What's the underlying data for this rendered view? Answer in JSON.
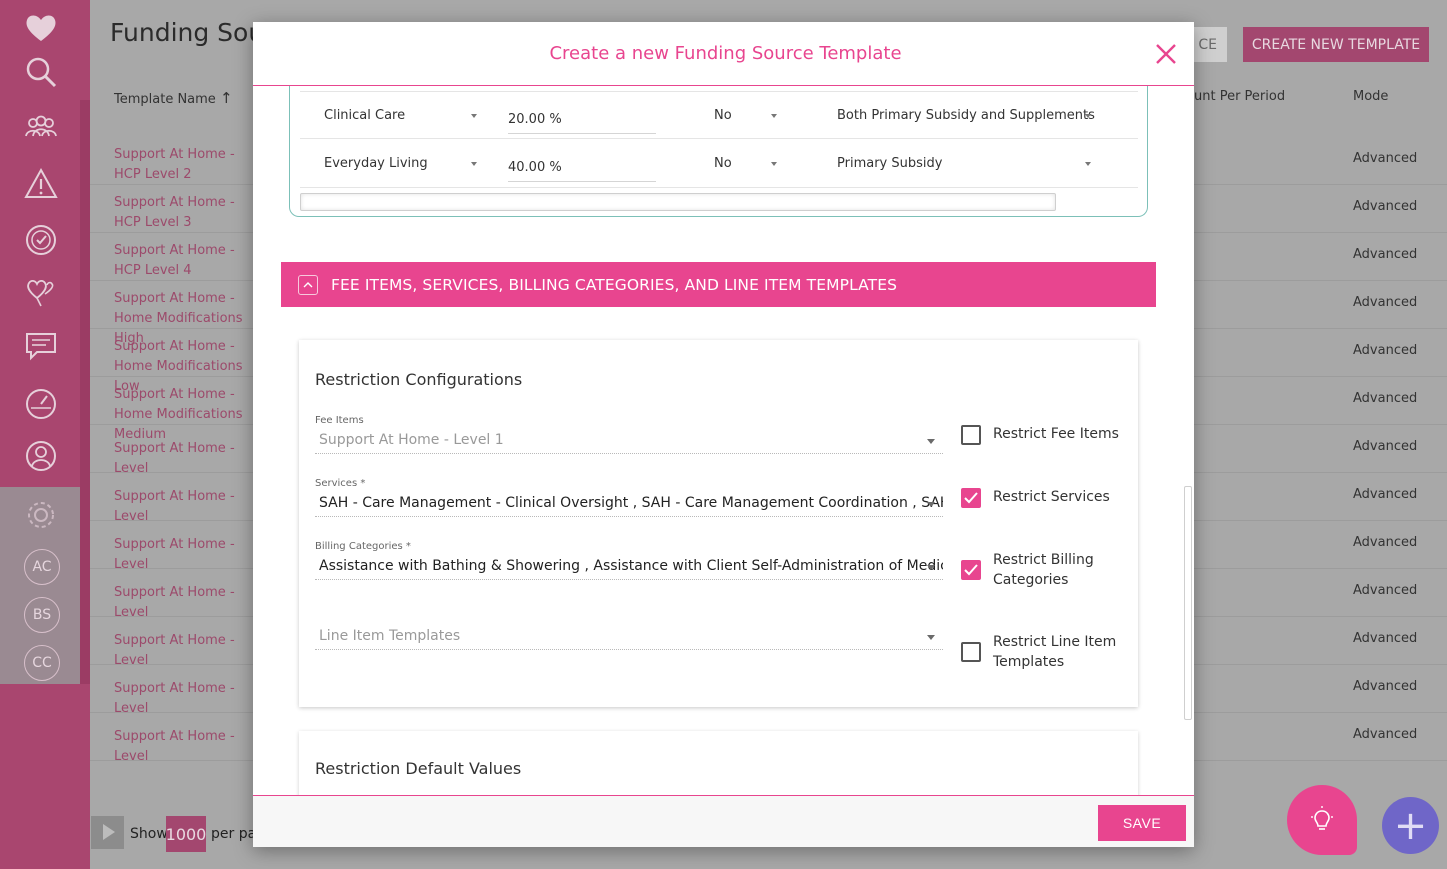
{
  "background": {
    "title": "Funding Sour",
    "buttons": {
      "partial_label": "CE",
      "create_label": "CREATE NEW TEMPLATE"
    },
    "columns": {
      "template_name": "Template Name",
      "amount": "unt Per Period",
      "mode": "Mode"
    },
    "rows": [
      {
        "name": "Support At Home - HCP Level 2",
        "mode": "Advanced"
      },
      {
        "name": "Support At Home - HCP Level 3",
        "mode": "Advanced"
      },
      {
        "name": "Support At Home - HCP Level 4",
        "mode": "Advanced"
      },
      {
        "name": "Support At Home - Home Modifications High",
        "mode": "Advanced"
      },
      {
        "name": "Support At Home - Home Modifications Low",
        "mode": "Advanced"
      },
      {
        "name": "Support At Home - Home Modifications Medium",
        "mode": "Advanced"
      },
      {
        "name": "Support At Home - Level",
        "mode": "Advanced"
      },
      {
        "name": "Support At Home - Level",
        "mode": "Advanced"
      },
      {
        "name": "Support At Home - Level",
        "mode": "Advanced"
      },
      {
        "name": "Support At Home - Level",
        "mode": "Advanced"
      },
      {
        "name": "Support At Home - Level",
        "mode": "Advanced"
      },
      {
        "name": "Support At Home - Level",
        "mode": "Advanced"
      },
      {
        "name": "Support At Home - Level",
        "mode": "Advanced"
      }
    ],
    "footer": {
      "show": "Show",
      "count": "1000",
      "per_page": "per pa"
    }
  },
  "sidebar": {
    "circles": [
      "AC",
      "BS",
      "CC"
    ]
  },
  "modal": {
    "title": "Create a new Funding Source Template",
    "subsidy_rows": [
      {
        "category": "Clinical Care",
        "percent": "20.00 %",
        "flag": "No",
        "applies": "Both Primary Subsidy and Supplements"
      },
      {
        "category": "Everyday Living",
        "percent": "40.00 %",
        "flag": "No",
        "applies": "Primary Subsidy"
      }
    ],
    "section_title": "FEE ITEMS, SERVICES, BILLING CATEGORIES, AND LINE ITEM TEMPLATES",
    "restriction_config": {
      "title": "Restriction Configurations",
      "fee_items": {
        "label": "Fee Items",
        "value": "Support At Home - Level 1",
        "restrict_label": "Restrict Fee Items",
        "checked": false
      },
      "services": {
        "label": "Services *",
        "value": "SAH - Care Management - Clinical Oversight , SAH - Care Management Coordination , SAH -...",
        "restrict_label": "Restrict Services",
        "checked": true
      },
      "billing": {
        "label": "Billing Categories *",
        "value": "Assistance with Bathing & Showering , Assistance with Client Self-Administration of Medici...",
        "restrict_label": "Restrict Billing Categories",
        "checked": true
      },
      "line_items": {
        "placeholder": "Line Item Templates",
        "restrict_label": "Restrict Line Item Templates",
        "checked": false
      }
    },
    "restriction_defaults": {
      "title": "Restriction Default Values"
    },
    "save_label": "SAVE"
  },
  "colors": {
    "accent": "#e8458f",
    "sidebar": "#a9466f",
    "fab_add": "#6f66c8"
  }
}
